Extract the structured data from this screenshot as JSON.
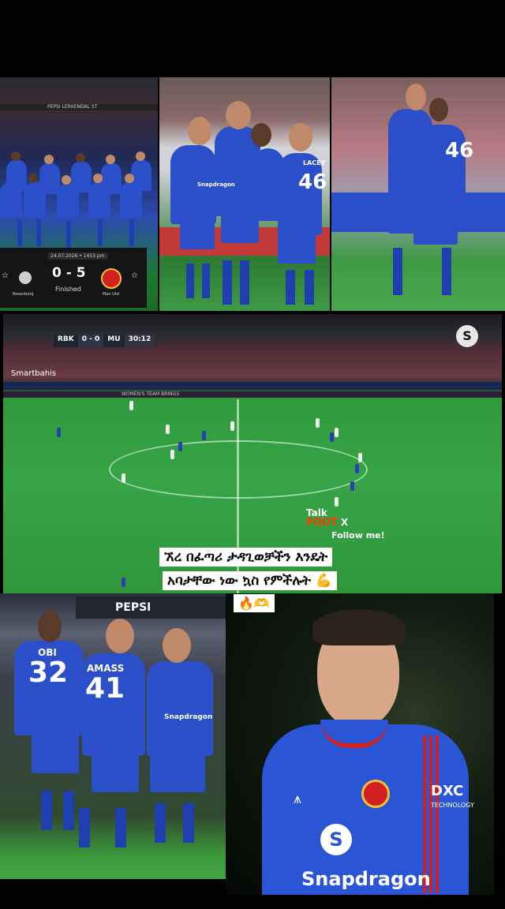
{
  "panel1": {
    "board_text": "PEPSI  LERKENDAL ST",
    "scorecard": {
      "date": "24.07.2026 • 1453 pm",
      "score": "0 - 5",
      "status": "Finished",
      "home_team": "Rosenborg",
      "away_team": "Man Utd",
      "star": "☆"
    }
  },
  "panel2": {
    "sponsor": "Snapdragon",
    "number": "46",
    "name": "LACEY"
  },
  "panel3": {
    "number": "46"
  },
  "broadcast": {
    "home": "RBK",
    "score": "0 - 0",
    "away": "MU",
    "time": "30:12",
    "channel_badge": "S",
    "ad": "Smartbahis",
    "ad_board": "WOMEN'S TEAM BRINGS"
  },
  "watermark": {
    "talk": "Talk",
    "foot": "FOOT",
    "x": "X",
    "follow": "Follow me!"
  },
  "caption": {
    "line1": "ኧረ በፈጣሪ ታዳጊወቻችን እንዴት",
    "line2": "አባታቸው ነው ኳስ የምችሉት 💪",
    "line3": "🔥🫶"
  },
  "panel5": {
    "board": "PEPSI",
    "players": [
      {
        "name": "OBI",
        "number": "32"
      },
      {
        "name": "AMASS",
        "number": "41"
      }
    ],
    "sponsor": "Snapdragon"
  },
  "panel6": {
    "adidas": "⩚",
    "dxc": "DXC",
    "dxc_sub": "TECHNOLOGY",
    "snap_logo": "S",
    "sponsor": "Snapdragon"
  },
  "colors": {
    "kit_blue": "#2a55d6",
    "kit_red": "#d21f1f",
    "pitch": "#36a545"
  }
}
